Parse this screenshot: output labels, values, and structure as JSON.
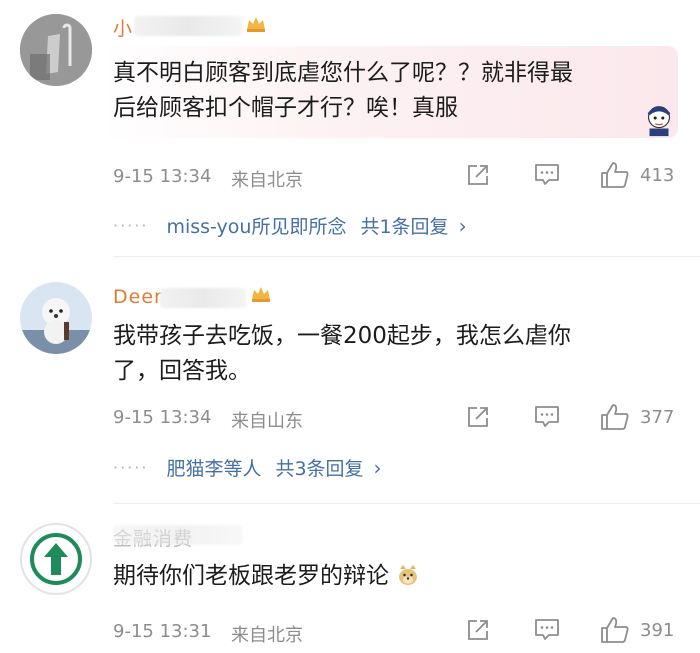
{
  "comments": [
    {
      "username": "小",
      "text_line1": "真不明白顾客到底虐您什么了呢？？就非得最",
      "text_line2": "后给顾客扣个帽子才行？唉！真服",
      "time": "9-15 13:34",
      "location": "来自北京",
      "likes": "413",
      "reply_users": "miss-you所见即所念",
      "reply_count": "共1条回复"
    },
    {
      "username": "Deer",
      "text_line1": "我带孩子去吃饭，一餐200起步，我怎么虐你",
      "text_line2": "了，回答我。",
      "time": "9-15 13:34",
      "location": "来自山东",
      "likes": "377",
      "reply_users": "肥猫李等人",
      "reply_count": "共3条回复"
    },
    {
      "username": "金融消费",
      "text_line1": "期待你们老板跟老罗的辩论",
      "time": "9-15 13:31",
      "location": "来自北京",
      "likes": "391"
    }
  ],
  "icons": {
    "share": "share-icon",
    "comment": "comment-icon",
    "like": "thumbs-up-icon"
  },
  "colors": {
    "username": "#e57a32",
    "reply_link": "#4670a6",
    "meta": "#8d8d8d",
    "avatar_green": "#1f8a5a"
  }
}
